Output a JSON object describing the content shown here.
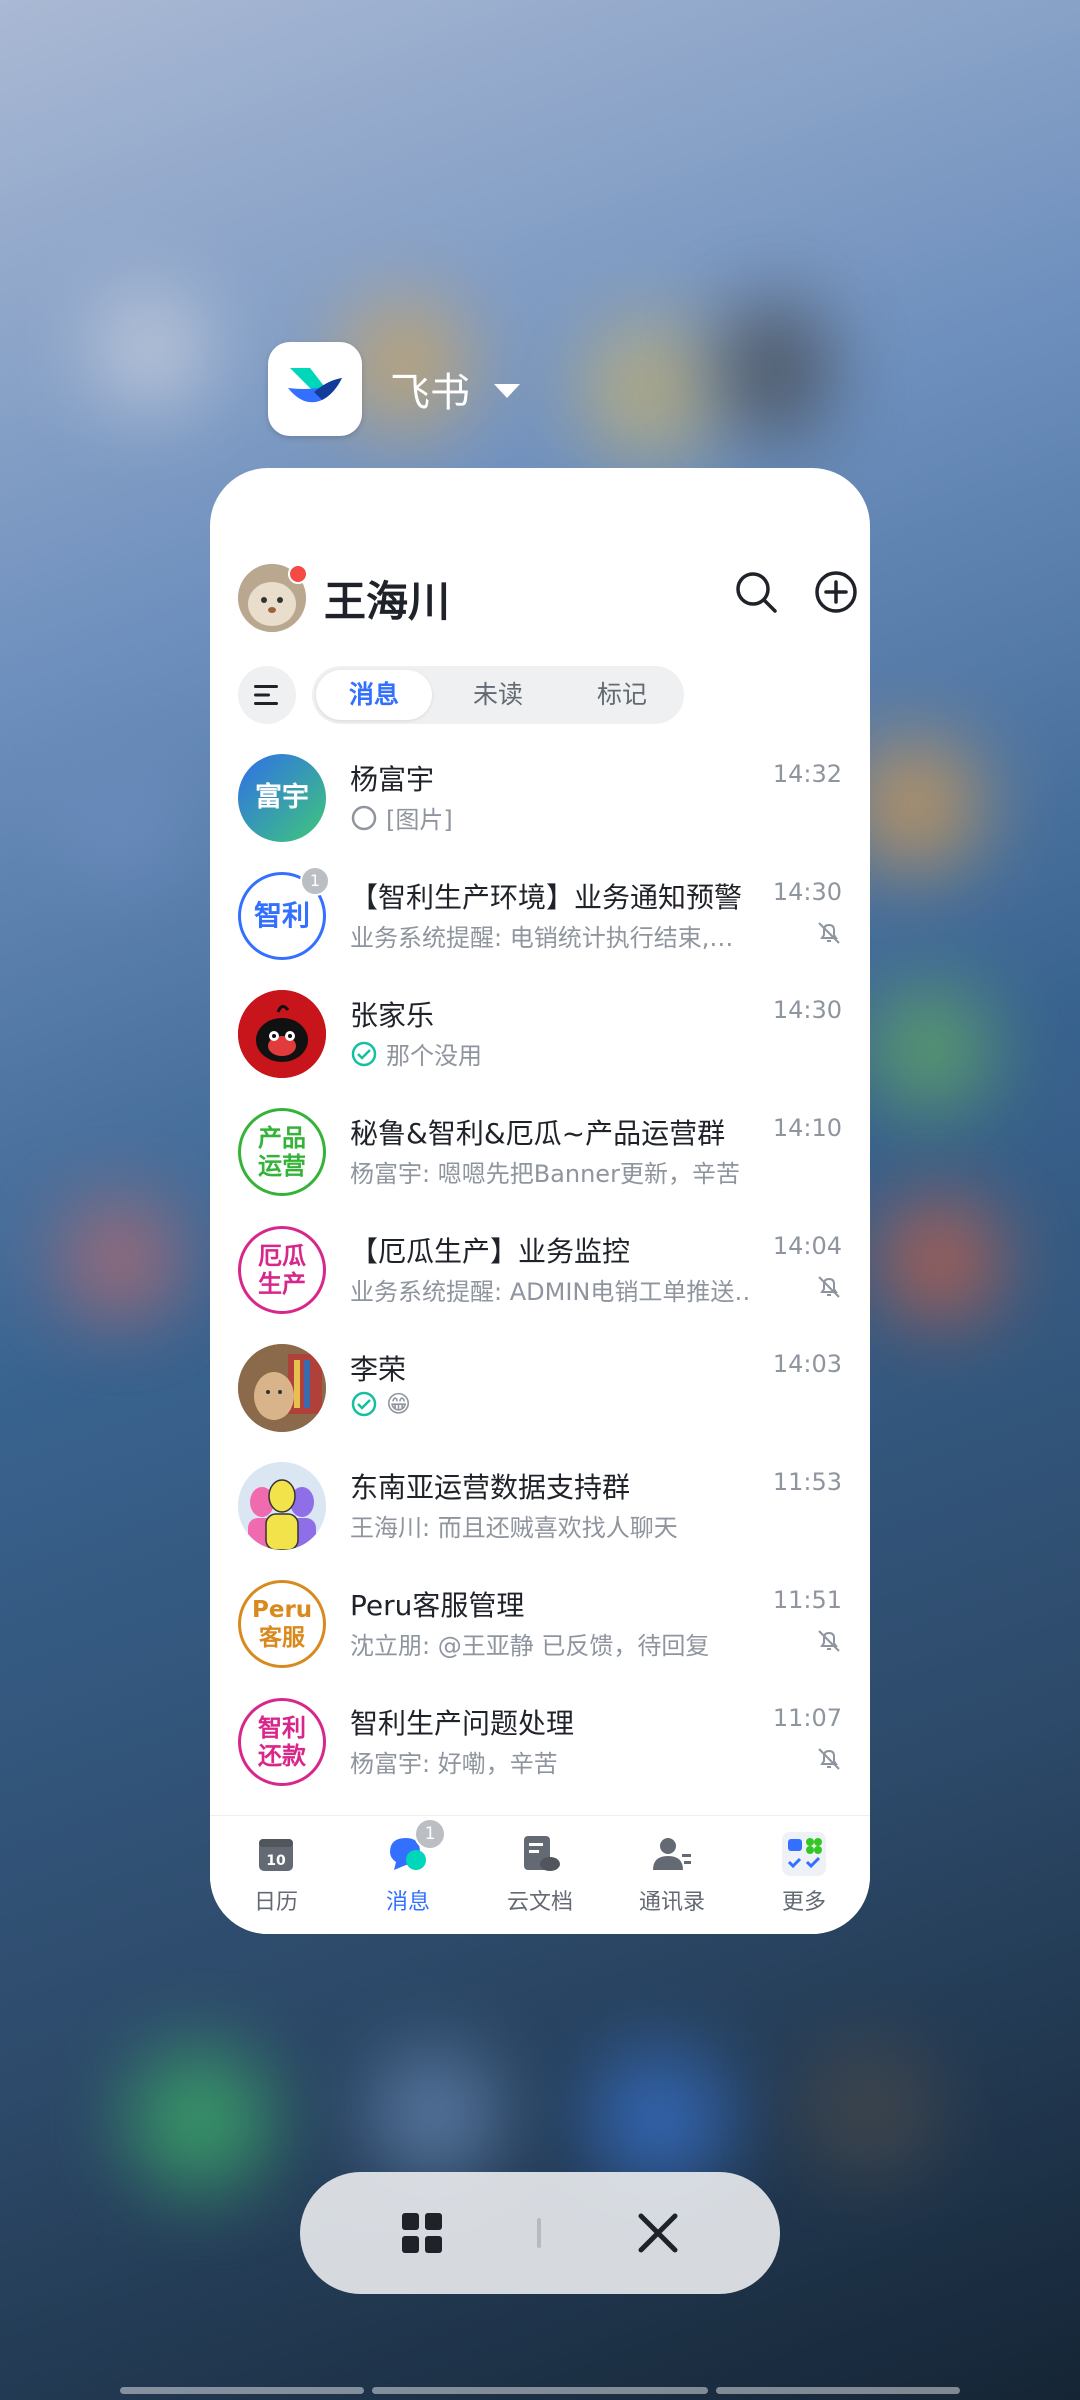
{
  "app_switcher": {
    "app_name": "飞书"
  },
  "header": {
    "user_name": "王海川"
  },
  "tabs": [
    {
      "label": "消息",
      "active": true
    },
    {
      "label": "未读",
      "active": false
    },
    {
      "label": "标记",
      "active": false
    }
  ],
  "chats": [
    {
      "avatar_text": "富宇",
      "title": "杨富宇",
      "subtitle": "[图片]",
      "time": "14:32",
      "status": "sending",
      "muted": false
    },
    {
      "avatar_text": "智利",
      "title": "【智利生产环境】业务通知预警",
      "subtitle": "业务系统提醒: 电销统计执行结束,…",
      "time": "14:30",
      "badge": "1",
      "muted": true
    },
    {
      "avatar_text": "",
      "title": "张家乐",
      "subtitle": "那个没用",
      "time": "14:30",
      "status": "read",
      "muted": false
    },
    {
      "avatar_text": "产品 运营",
      "title": "秘鲁&智利&厄瓜~产品运营群",
      "subtitle": "杨富宇: 嗯嗯先把Banner更新，辛苦",
      "time": "14:10",
      "muted": false
    },
    {
      "avatar_text": "厄瓜 生产",
      "title": "【厄瓜生产】业务监控",
      "subtitle": "业务系统提醒: ADMIN电销工单推送…",
      "time": "14:04",
      "muted": true
    },
    {
      "avatar_text": "",
      "title": "李荣",
      "subtitle": "😁",
      "time": "14:03",
      "status": "read",
      "muted": false
    },
    {
      "avatar_text": "",
      "title": "东南亚运营数据支持群",
      "subtitle": "王海川: 而且还贼喜欢找人聊天",
      "time": "11:53",
      "muted": false
    },
    {
      "avatar_text": "Peru 客服",
      "title": "Peru客服管理",
      "subtitle": "沈立朋: @王亚静 已反馈，待回复",
      "time": "11:51",
      "muted": true
    },
    {
      "avatar_text": "智利 还款",
      "title": "智利生产问题处理",
      "subtitle": "杨富宇: 好嘞，辛苦",
      "time": "11:07",
      "muted": true
    }
  ],
  "tabbar": {
    "items": [
      {
        "label": "日历",
        "icon": "calendar-icon",
        "icon_text": "10"
      },
      {
        "label": "消息",
        "icon": "chat-icon",
        "badge": "1",
        "active": true
      },
      {
        "label": "云文档",
        "icon": "docs-icon"
      },
      {
        "label": "通讯录",
        "icon": "contacts-icon"
      },
      {
        "label": "更多",
        "icon": "apps-icon"
      }
    ]
  },
  "colors": {
    "accent": "#3370ff",
    "text": "#1f2329",
    "secondary": "#8f959e"
  }
}
